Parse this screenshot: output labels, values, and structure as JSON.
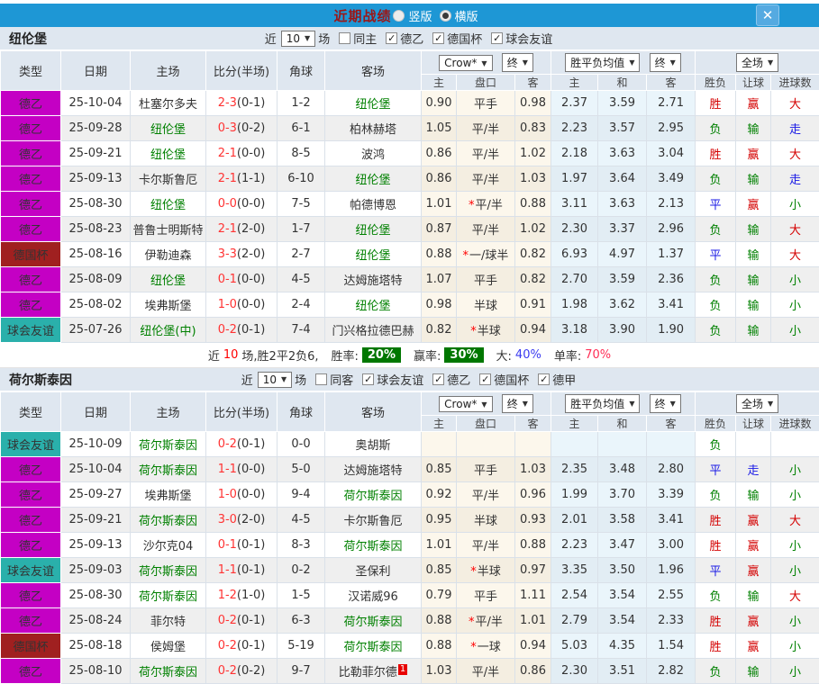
{
  "titlebar": {
    "title": "近期战绩",
    "vertical_label": "竖版",
    "horizontal_label": "横版",
    "close_glyph": "✕"
  },
  "header": {
    "cols": [
      "类型",
      "日期",
      "主场",
      "比分(半场)",
      "角球",
      "客场"
    ],
    "sub": [
      "主",
      "盘口",
      "客",
      "主",
      "和",
      "客",
      "胜负",
      "让球",
      "进球数"
    ],
    "provider": "Crow*",
    "stage1": "终",
    "mean": "胜平负均值",
    "stage2": "终",
    "scope": "全场"
  },
  "type_colors": {
    "德乙": "#c400c4",
    "德国杯": "#a02020",
    "球会友谊": "#2ab0ab"
  },
  "outcome_colors": {
    "胜": "#d40000",
    "平": "#1a1ae6",
    "负": "#008000",
    "赢": "#d40000",
    "走": "#1a1ae6",
    "输": "#008000",
    "大": "#d40000",
    "小": "#008000"
  },
  "sections": [
    {
      "team": "纽伦堡",
      "filters": {
        "near": "近",
        "count": "10",
        "games": "场",
        "same": "同主",
        "leagues": [
          "德乙",
          "德国杯",
          "球会友谊"
        ]
      },
      "rows": [
        {
          "type": "德乙",
          "date": "25-10-04",
          "home": "杜塞尔多夫",
          "home_self": false,
          "score": "2-3",
          "half": "(0-1)",
          "corner": "1-2",
          "away": "纽伦堡",
          "away_self": true,
          "odds_home": "0.90",
          "handicap": "平手",
          "odds_away": "0.98",
          "avg_home": "2.37",
          "avg_draw": "3.59",
          "avg_away": "2.71",
          "result": "胜",
          "handicap_result": "赢",
          "goal_result": "大"
        },
        {
          "type": "德乙",
          "date": "25-09-28",
          "home": "纽伦堡",
          "home_self": true,
          "score": "0-3",
          "half": "(0-2)",
          "corner": "6-1",
          "away": "柏林赫塔",
          "away_self": false,
          "odds_home": "1.05",
          "handicap": "平/半",
          "odds_away": "0.83",
          "avg_home": "2.23",
          "avg_draw": "3.57",
          "avg_away": "2.95",
          "result": "负",
          "handicap_result": "输",
          "goal_result": "走"
        },
        {
          "type": "德乙",
          "date": "25-09-21",
          "home": "纽伦堡",
          "home_self": true,
          "score": "2-1",
          "half": "(0-0)",
          "corner": "8-5",
          "away": "波鸿",
          "away_self": false,
          "odds_home": "0.86",
          "handicap": "平/半",
          "odds_away": "1.02",
          "avg_home": "2.18",
          "avg_draw": "3.63",
          "avg_away": "3.04",
          "result": "胜",
          "handicap_result": "赢",
          "goal_result": "大"
        },
        {
          "type": "德乙",
          "date": "25-09-13",
          "home": "卡尔斯鲁厄",
          "home_self": false,
          "score": "2-1",
          "half": "(1-1)",
          "corner": "6-10",
          "away": "纽伦堡",
          "away_self": true,
          "odds_home": "0.86",
          "handicap": "平/半",
          "odds_away": "1.03",
          "avg_home": "1.97",
          "avg_draw": "3.64",
          "avg_away": "3.49",
          "result": "负",
          "handicap_result": "输",
          "goal_result": "走"
        },
        {
          "type": "德乙",
          "date": "25-08-30",
          "home": "纽伦堡",
          "home_self": true,
          "score": "0-0",
          "half": "(0-0)",
          "corner": "7-5",
          "away": "帕德博恩",
          "away_self": false,
          "odds_home": "1.01",
          "handicap": "*平/半",
          "odds_away": "0.88",
          "avg_home": "3.11",
          "avg_draw": "3.63",
          "avg_away": "2.13",
          "result": "平",
          "handicap_result": "赢",
          "goal_result": "小"
        },
        {
          "type": "德乙",
          "date": "25-08-23",
          "home": "普鲁士明斯特",
          "home_self": false,
          "score": "2-1",
          "half": "(2-0)",
          "corner": "1-7",
          "away": "纽伦堡",
          "away_self": true,
          "odds_home": "0.87",
          "handicap": "平/半",
          "odds_away": "1.02",
          "avg_home": "2.30",
          "avg_draw": "3.37",
          "avg_away": "2.96",
          "result": "负",
          "handicap_result": "输",
          "goal_result": "大"
        },
        {
          "type": "德国杯",
          "date": "25-08-16",
          "home": "伊勒迪森",
          "home_self": false,
          "score": "3-3",
          "half": "(2-0)",
          "corner": "2-7",
          "away": "纽伦堡",
          "away_self": true,
          "odds_home": "0.88",
          "handicap": "*一/球半",
          "odds_away": "0.82",
          "avg_home": "6.93",
          "avg_draw": "4.97",
          "avg_away": "1.37",
          "result": "平",
          "handicap_result": "输",
          "goal_result": "大"
        },
        {
          "type": "德乙",
          "date": "25-08-09",
          "home": "纽伦堡",
          "home_self": true,
          "score": "0-1",
          "half": "(0-0)",
          "corner": "4-5",
          "away": "达姆施塔特",
          "away_self": false,
          "odds_home": "1.07",
          "handicap": "平手",
          "odds_away": "0.82",
          "avg_home": "2.70",
          "avg_draw": "3.59",
          "avg_away": "2.36",
          "result": "负",
          "handicap_result": "输",
          "goal_result": "小"
        },
        {
          "type": "德乙",
          "date": "25-08-02",
          "home": "埃弗斯堡",
          "home_self": false,
          "score": "1-0",
          "half": "(0-0)",
          "corner": "2-4",
          "away": "纽伦堡",
          "away_self": true,
          "odds_home": "0.98",
          "handicap": "半球",
          "odds_away": "0.91",
          "avg_home": "1.98",
          "avg_draw": "3.62",
          "avg_away": "3.41",
          "result": "负",
          "handicap_result": "输",
          "goal_result": "小"
        },
        {
          "type": "球会友谊",
          "date": "25-07-26",
          "home": "纽伦堡(中)",
          "home_self": true,
          "score": "0-2",
          "half": "(0-1)",
          "corner": "7-4",
          "away": "门兴格拉德巴赫",
          "away_self": false,
          "odds_home": "0.82",
          "handicap": "*半球",
          "odds_away": "0.94",
          "avg_home": "3.18",
          "avg_draw": "3.90",
          "avg_away": "1.90",
          "result": "负",
          "handicap_result": "输",
          "goal_result": "小"
        }
      ],
      "summary": {
        "prefix": "近",
        "games": "10",
        "mid": "场,胜2平2负6,",
        "win_label": "胜率:",
        "win_rate": "20%",
        "profit_label": "赢率:",
        "profit_rate": "30%",
        "big_label": "大:",
        "big_rate": "40%",
        "single_label": "单率:",
        "single_rate": "70%"
      }
    },
    {
      "team": "荷尔斯泰因",
      "filters": {
        "near": "近",
        "count": "10",
        "games": "场",
        "same": "同客",
        "leagues": [
          "球会友谊",
          "德乙",
          "德国杯",
          "德甲"
        ]
      },
      "rows": [
        {
          "type": "球会友谊",
          "date": "25-10-09",
          "home": "荷尔斯泰因",
          "home_self": true,
          "score": "0-2",
          "half": "(0-1)",
          "corner": "0-0",
          "away": "奥胡斯",
          "away_self": false,
          "odds_home": "",
          "handicap": "",
          "odds_away": "",
          "avg_home": "",
          "avg_draw": "",
          "avg_away": "",
          "result": "负",
          "handicap_result": "",
          "goal_result": ""
        },
        {
          "type": "德乙",
          "date": "25-10-04",
          "home": "荷尔斯泰因",
          "home_self": true,
          "score": "1-1",
          "half": "(0-0)",
          "corner": "5-0",
          "away": "达姆施塔特",
          "away_self": false,
          "odds_home": "0.85",
          "handicap": "平手",
          "odds_away": "1.03",
          "avg_home": "2.35",
          "avg_draw": "3.48",
          "avg_away": "2.80",
          "result": "平",
          "handicap_result": "走",
          "goal_result": "小"
        },
        {
          "type": "德乙",
          "date": "25-09-27",
          "home": "埃弗斯堡",
          "home_self": false,
          "score": "1-0",
          "half": "(0-0)",
          "corner": "9-4",
          "away": "荷尔斯泰因",
          "away_self": true,
          "odds_home": "0.92",
          "handicap": "平/半",
          "odds_away": "0.96",
          "avg_home": "1.99",
          "avg_draw": "3.70",
          "avg_away": "3.39",
          "result": "负",
          "handicap_result": "输",
          "goal_result": "小"
        },
        {
          "type": "德乙",
          "date": "25-09-21",
          "home": "荷尔斯泰因",
          "home_self": true,
          "score": "3-0",
          "half": "(2-0)",
          "corner": "4-5",
          "away": "卡尔斯鲁厄",
          "away_self": false,
          "odds_home": "0.95",
          "handicap": "半球",
          "odds_away": "0.93",
          "avg_home": "2.01",
          "avg_draw": "3.58",
          "avg_away": "3.41",
          "result": "胜",
          "handicap_result": "赢",
          "goal_result": "大"
        },
        {
          "type": "德乙",
          "date": "25-09-13",
          "home": "沙尔克04",
          "home_self": false,
          "score": "0-1",
          "half": "(0-1)",
          "corner": "8-3",
          "away": "荷尔斯泰因",
          "away_self": true,
          "odds_home": "1.01",
          "handicap": "平/半",
          "odds_away": "0.88",
          "avg_home": "2.23",
          "avg_draw": "3.47",
          "avg_away": "3.00",
          "result": "胜",
          "handicap_result": "赢",
          "goal_result": "小"
        },
        {
          "type": "球会友谊",
          "date": "25-09-03",
          "home": "荷尔斯泰因",
          "home_self": true,
          "score": "1-1",
          "half": "(0-1)",
          "corner": "0-2",
          "away": "圣保利",
          "away_self": false,
          "odds_home": "0.85",
          "handicap": "*半球",
          "odds_away": "0.97",
          "avg_home": "3.35",
          "avg_draw": "3.50",
          "avg_away": "1.96",
          "result": "平",
          "handicap_result": "赢",
          "goal_result": "小"
        },
        {
          "type": "德乙",
          "date": "25-08-30",
          "home": "荷尔斯泰因",
          "home_self": true,
          "score": "1-2",
          "half": "(1-0)",
          "corner": "1-5",
          "away": "汉诺威96",
          "away_self": false,
          "odds_home": "0.79",
          "handicap": "平手",
          "odds_away": "1.11",
          "avg_home": "2.54",
          "avg_draw": "3.54",
          "avg_away": "2.55",
          "result": "负",
          "handicap_result": "输",
          "goal_result": "大"
        },
        {
          "type": "德乙",
          "date": "25-08-24",
          "home": "菲尔特",
          "home_self": false,
          "score": "0-2",
          "half": "(0-1)",
          "corner": "6-3",
          "away": "荷尔斯泰因",
          "away_self": true,
          "odds_home": "0.88",
          "handicap": "*平/半",
          "odds_away": "1.01",
          "avg_home": "2.79",
          "avg_draw": "3.54",
          "avg_away": "2.33",
          "result": "胜",
          "handicap_result": "赢",
          "goal_result": "小"
        },
        {
          "type": "德国杯",
          "date": "25-08-18",
          "home": "侯姆堡",
          "home_self": false,
          "score": "0-2",
          "half": "(0-1)",
          "corner": "5-19",
          "away": "荷尔斯泰因",
          "away_self": true,
          "odds_home": "0.88",
          "handicap": "*一球",
          "odds_away": "0.94",
          "avg_home": "5.03",
          "avg_draw": "4.35",
          "avg_away": "1.54",
          "result": "胜",
          "handicap_result": "赢",
          "goal_result": "小"
        },
        {
          "type": "德乙",
          "date": "25-08-10",
          "home": "荷尔斯泰因",
          "home_self": true,
          "score": "0-2",
          "half": "(0-2)",
          "corner": "9-7",
          "away": "比勒菲尔德",
          "away_self": false,
          "away_sup": "1",
          "odds_home": "1.03",
          "handicap": "平/半",
          "odds_away": "0.86",
          "avg_home": "2.30",
          "avg_draw": "3.51",
          "avg_away": "2.82",
          "result": "负",
          "handicap_result": "输",
          "goal_result": "小"
        }
      ]
    }
  ]
}
